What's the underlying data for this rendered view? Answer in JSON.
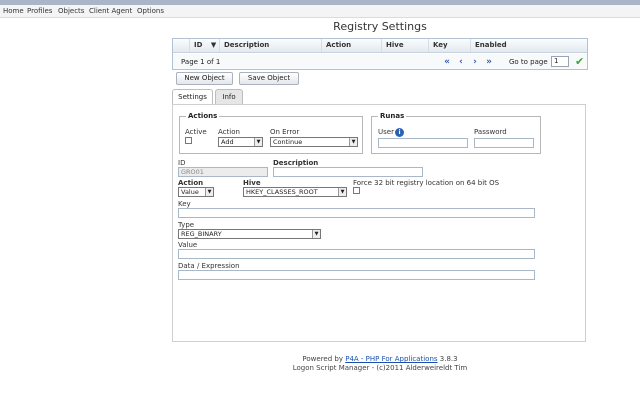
{
  "menu": {
    "items": [
      "Home",
      "Profiles",
      "Objects",
      "Client Agent",
      "Options"
    ]
  },
  "page": {
    "title": "Registry Settings"
  },
  "grid": {
    "columns": [
      "ID",
      "Description",
      "Action",
      "Hive",
      "Key",
      "Enabled"
    ],
    "sort_icon": "sort-desc-icon",
    "page_info": "Page 1 of 1",
    "goto_label": "Go to page",
    "goto_value": "1",
    "nav_icons": [
      "first-page-icon",
      "prev-page-icon",
      "next-page-icon",
      "last-page-icon"
    ]
  },
  "toolbar": {
    "new_label": "New Object",
    "save_label": "Save Object"
  },
  "tabs": [
    "Settings",
    "Info"
  ],
  "form": {
    "actions_legend": "Actions",
    "active_label": "Active",
    "action_label": "Action",
    "action_value": "Add",
    "onerror_label": "On Error",
    "onerror_value": "Continue",
    "runas_legend": "Runas",
    "user_label": "User",
    "password_label": "Password",
    "id_label": "ID",
    "id_value": "GRO01",
    "description_label": "Description",
    "action2_label": "Action",
    "action2_value": "Value",
    "hive_label": "Hive",
    "hive_value": "HKEY_CLASSES_ROOT",
    "force32_label": "Force 32 bit registry location on 64 bit OS",
    "key_label": "Key",
    "type_label": "Type",
    "type_value": "REG_BINARY",
    "value_label": "Value",
    "data_label": "Data / Expression"
  },
  "footer": {
    "powered_prefix": "Powered by",
    "powered_link": "P4A - PHP For Applications",
    "powered_version": "3.8.3",
    "line2": "Logon Script Manager - (c)2011 Alderweireldt Tim"
  },
  "colors": {
    "link": "#1a4fb0",
    "nav_arrow": "#2a58a8",
    "confirm": "#3aa63a",
    "topbar": "#a9b6c8"
  }
}
